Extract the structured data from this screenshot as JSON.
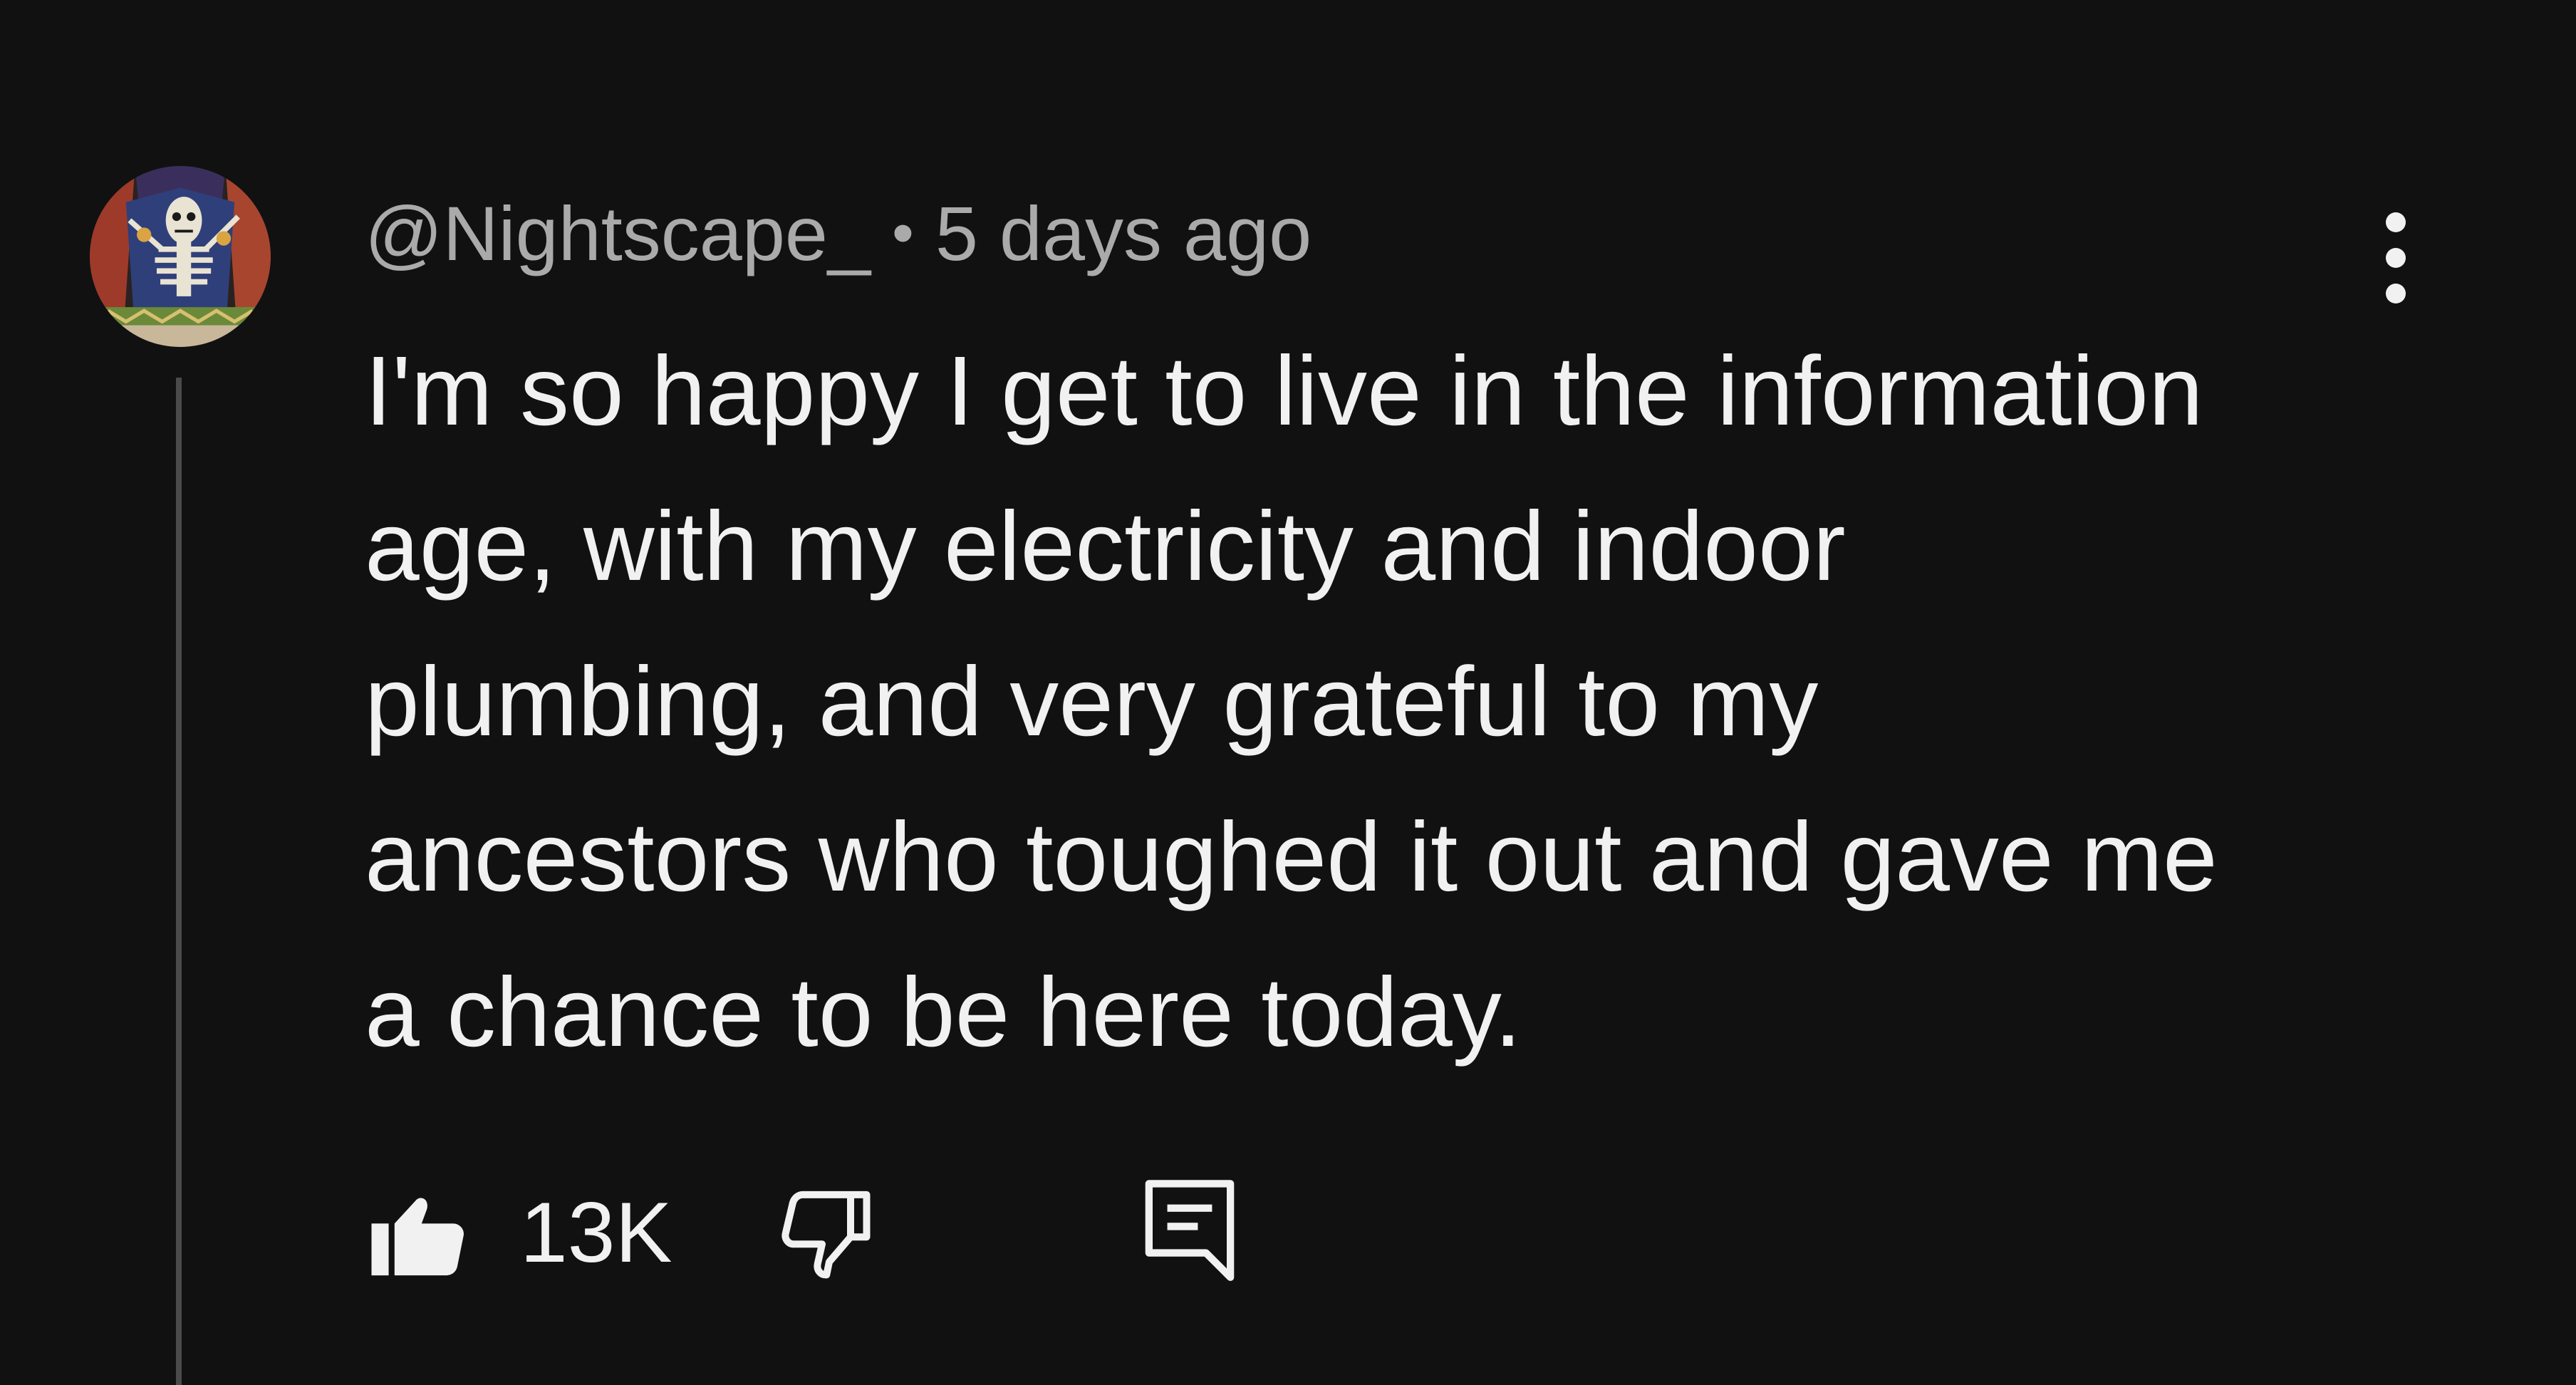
{
  "comment": {
    "author": "@Nightscape_",
    "separator": "•",
    "timestamp": "5 days ago",
    "lines": [
      "I'm so happy I get to live in the information",
      "age, with my electricity and indoor",
      "plumbing, and very grateful to my",
      "ancestors who toughed it out and gave me",
      "a chance to be here today."
    ],
    "likes": "13K"
  },
  "icons": {
    "avatar": "skeleton-painting-avatar",
    "more": "more-vertical-icon",
    "like": "thumbs-up-filled-icon",
    "dislike": "thumbs-down-outline-icon",
    "reply": "comment-reply-icon"
  },
  "colors": {
    "background": "#111111",
    "text": "#f1f1f1",
    "meta": "#aaaaaa",
    "thread_line": "#4a4a4a"
  }
}
